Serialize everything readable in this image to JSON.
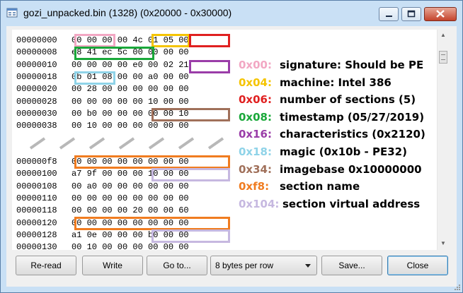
{
  "window": {
    "title": "gozi_unpacked.bin (1328) (0x20000 - 0x30000)"
  },
  "hex_rows_top": [
    {
      "offset": "00000000",
      "bytes": "00 00 00 00 4c 01 05 00"
    },
    {
      "offset": "00000008",
      "bytes": "e8 41 ec 5c 00 00 00 00"
    },
    {
      "offset": "00000010",
      "bytes": "00 00 00 00 e0 00 02 21"
    },
    {
      "offset": "00000018",
      "bytes": "0b 01 08 00 00 a0 00 00"
    },
    {
      "offset": "00000020",
      "bytes": "00 28 00 00 00 00 00 00"
    },
    {
      "offset": "00000028",
      "bytes": "00 00 00 00 00 10 00 00"
    },
    {
      "offset": "00000030",
      "bytes": "00 b0 00 00 00 00 00 10"
    },
    {
      "offset": "00000038",
      "bytes": "00 10 00 00 00 00 00 00"
    }
  ],
  "hex_rows_bottom": [
    {
      "offset": "000000f8",
      "bytes": "00 00 00 00 00 00 00 00"
    },
    {
      "offset": "00000100",
      "bytes": "a7 9f 00 00 00 10 00 00"
    },
    {
      "offset": "00000108",
      "bytes": "00 a0 00 00 00 00 00 00"
    },
    {
      "offset": "00000110",
      "bytes": "00 00 00 00 00 00 00 00"
    },
    {
      "offset": "00000118",
      "bytes": "00 00 00 00 20 00 00 60"
    },
    {
      "offset": "00000120",
      "bytes": "00 00 00 00 00 00 00 00"
    },
    {
      "offset": "00000128",
      "bytes": "a1 0e 00 00 00 b0 00 00"
    },
    {
      "offset": "00000130",
      "bytes": "00 10 00 00 00 00 00 00"
    }
  ],
  "legend": [
    {
      "code": "0x00:",
      "desc": "signature: Should be PE",
      "color": "#f2a7c3"
    },
    {
      "code": "0x04:",
      "desc": "machine: Intel 386",
      "color": "#f5c400"
    },
    {
      "code": "0x06:",
      "desc": "number of sections (5)",
      "color": "#e02020"
    },
    {
      "code": "0x08:",
      "desc": "timestamp (05/27/2019)",
      "color": "#1aa83a"
    },
    {
      "code": "0x16:",
      "desc": "characteristics (0x2120)",
      "color": "#9a3da8"
    },
    {
      "code": "0x18:",
      "desc": "magic (0x10b - PE32)",
      "color": "#8fd3e8"
    },
    {
      "code": "0x34:",
      "desc": "imagebase 0x10000000",
      "color": "#a0705a"
    },
    {
      "code": "0xf8:",
      "desc": "section name",
      "color": "#f07c20"
    },
    {
      "code": "0x104:",
      "desc": "section virtual address",
      "color": "#c6b8e0"
    }
  ],
  "buttons": {
    "reread": "Re-read",
    "write": "Write",
    "goto": "Go to...",
    "save": "Save...",
    "close": "Close"
  },
  "bytes_per_row": "8 bytes per row",
  "colors": {
    "pink": "#f2a7c3",
    "yellow": "#f5c400",
    "red": "#e02020",
    "green": "#1aa83a",
    "purple": "#9a3da8",
    "lightblue": "#8fd3e8",
    "brown": "#a0705a",
    "orange": "#f07c20",
    "lavender": "#c6b8e0"
  }
}
